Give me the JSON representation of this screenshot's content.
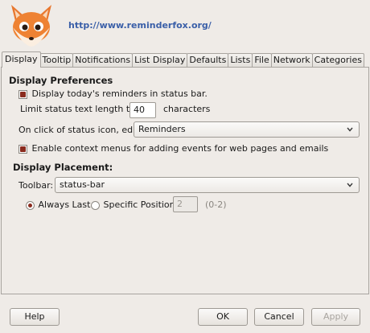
{
  "header": {
    "url": "http://www.reminderfox.org/",
    "logo_icon": "fox-logo-icon"
  },
  "tabs": [
    {
      "label": "Display",
      "active": true
    },
    {
      "label": "Tooltip"
    },
    {
      "label": "Notifications"
    },
    {
      "label": "List Display"
    },
    {
      "label": "Defaults"
    },
    {
      "label": "Lists"
    },
    {
      "label": "File"
    },
    {
      "label": "Network"
    },
    {
      "label": "Categories"
    }
  ],
  "display_preferences": {
    "heading": "Display Preferences",
    "show_status_label": "Display today's reminders in status bar.",
    "show_status_checked": true,
    "limit_label": "Limit status text length to:",
    "limit_value": "40",
    "limit_unit": "characters",
    "onclick_label": "On click of status icon, edit:",
    "onclick_value": "Reminders",
    "context_menu_label": "Enable context menus for adding events for web pages and emails",
    "context_menu_checked": true
  },
  "display_placement": {
    "heading": "Display Placement:",
    "toolbar_label": "Toolbar:",
    "toolbar_value": "status-bar",
    "always_last_label": "Always Last",
    "always_last_selected": true,
    "specific_position_label": "Specific Position",
    "position_value": "2",
    "position_range": "(0-2)"
  },
  "buttons": {
    "help": "Help",
    "ok": "OK",
    "cancel": "Cancel",
    "apply": "Apply"
  }
}
